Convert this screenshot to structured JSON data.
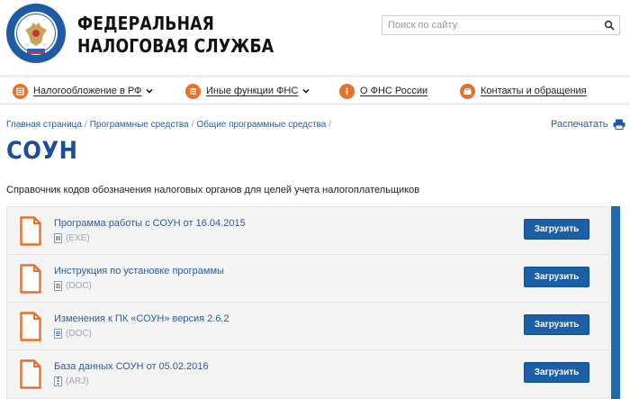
{
  "header": {
    "site_name_line1": "ФЕДЕРАЛЬНАЯ",
    "site_name_line2": "НАЛОГОВАЯ СЛУЖБА",
    "search_placeholder": "Поиск по сайту",
    "logo_icon": "fns-emblem-icon",
    "search_icon": "search-icon"
  },
  "nav": {
    "items": [
      {
        "label": "Налогообложение в РФ",
        "icon": "tax-icon",
        "has_dropdown": true
      },
      {
        "label": "Иные функции ФНС",
        "icon": "menu-icon",
        "has_dropdown": true
      },
      {
        "label": "О ФНС России",
        "icon": "info-icon",
        "has_dropdown": false
      },
      {
        "label": "Контакты и обращения",
        "icon": "phone-icon",
        "has_dropdown": false
      }
    ]
  },
  "breadcrumb": {
    "items": [
      "Главная страница",
      "Программные средства",
      "Общие программные средства"
    ],
    "separator": "/"
  },
  "print_label": "Распечатать",
  "page_title": "СОУН",
  "description": "Справочник кодов обозначения налоговых органов для целей учета налогоплательщиков",
  "files": [
    {
      "title": "Программа работы с СОУН от 16.04.2015",
      "type": "(EXE)",
      "button": "Загрузить"
    },
    {
      "title": "Инструкция по установке программы",
      "type": "(DOC)",
      "button": "Загрузить"
    },
    {
      "title": "Изменения к ПК «СОУН» версия 2.6.2",
      "type": "(DOC)",
      "button": "Загрузить"
    },
    {
      "title": "База данных СОУН от 05.02.2016",
      "type": "(ARJ)",
      "button": "Загрузить"
    }
  ],
  "colors": {
    "brand_blue": "#1a4f95",
    "link_blue": "#2a5c9a",
    "button_blue": "#1b5fa8",
    "accent_orange": "#e8702a"
  }
}
